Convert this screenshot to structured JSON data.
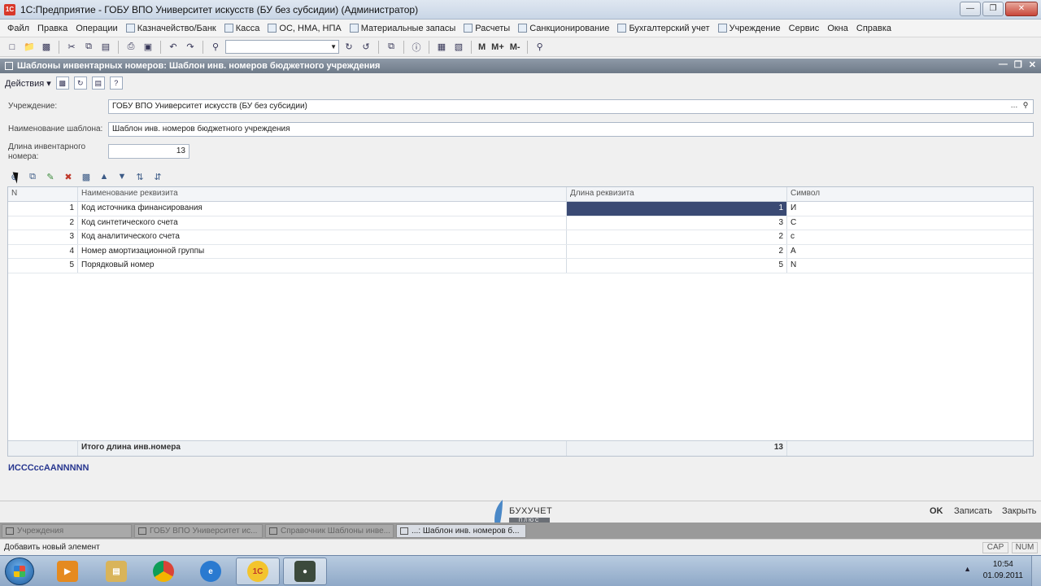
{
  "window": {
    "title": "1С:Предприятие - ГОБУ ВПО Университет искусств (БУ без субсидии) (Администратор)"
  },
  "menu": [
    {
      "label": "Файл",
      "icon": ""
    },
    {
      "label": "Правка",
      "icon": ""
    },
    {
      "label": "Операции",
      "icon": ""
    },
    {
      "label": "Казначейство/Банк",
      "icon": "bank-icon"
    },
    {
      "label": "Касса",
      "icon": "cash-icon"
    },
    {
      "label": "ОС, НМА, НПА",
      "icon": "assets-icon"
    },
    {
      "label": "Материальные запасы",
      "icon": "materials-icon"
    },
    {
      "label": "Расчеты",
      "icon": "settlements-icon"
    },
    {
      "label": "Санкционирование",
      "icon": "sanction-icon"
    },
    {
      "label": "Бухгалтерский учет",
      "icon": "accounting-icon"
    },
    {
      "label": "Учреждение",
      "icon": "institution-icon"
    },
    {
      "label": "Сервис",
      "icon": ""
    },
    {
      "label": "Окна",
      "icon": ""
    },
    {
      "label": "Справка",
      "icon": ""
    }
  ],
  "toolbar": {
    "m_label": "M",
    "m_plus_label": "M+",
    "m_minus_label": "M-"
  },
  "document": {
    "header_title": "Шаблоны инвентарных номеров: Шаблон инв. номеров бюджетного учреждения",
    "actions_label": "Действия"
  },
  "form": {
    "institution_label": "Учреждение:",
    "institution_value": "ГОБУ ВПО Университет искусств (БУ без субсидии)",
    "template_name_label": "Наименование шаблона:",
    "template_name_value": "Шаблон инв. номеров бюджетного учреждения",
    "inv_length_label_1": "Длина инвентарного",
    "inv_length_label_2": "номера:",
    "inv_length_value": "13"
  },
  "grid": {
    "columns": [
      "N",
      "Наименование реквизита",
      "Длина реквизита",
      "Символ"
    ],
    "rows": [
      {
        "n": "1",
        "name": "Код источника финансирования",
        "length": "1",
        "symbol": "И"
      },
      {
        "n": "2",
        "name": "Код синтетического счета",
        "length": "3",
        "symbol": "С"
      },
      {
        "n": "3",
        "name": "Код аналитического счета",
        "length": "2",
        "symbol": "с"
      },
      {
        "n": "4",
        "name": "Номер амортизационной группы",
        "length": "2",
        "symbol": "А"
      },
      {
        "n": "5",
        "name": "Порядковый номер",
        "length": "5",
        "symbol": "N"
      }
    ],
    "footer_label": "Итого длина инв.номера",
    "footer_total": "13"
  },
  "inv_mask": "ИСССссААNNNNN",
  "buttons": {
    "ok": "OK",
    "save": "Записать",
    "close": "Закрыть"
  },
  "logo": {
    "brand": "БУХУЧЕТ",
    "sub": "ПЛЮС"
  },
  "window_tabs": [
    {
      "label": "Учреждения",
      "active": false
    },
    {
      "label": "ГОБУ ВПО Университет ис...",
      "active": false
    },
    {
      "label": "Справочник Шаблоны инве...",
      "active": false
    },
    {
      "label": "...: Шаблон инв. номеров б...",
      "active": true
    }
  ],
  "status": {
    "message": "Добавить новый элемент",
    "cap": "CAP",
    "num": "NUM"
  },
  "taskbar": {
    "time": "10:54",
    "date": "01.09.2011"
  },
  "colors": {
    "selection": "#3a4a74",
    "mask_text": "#27368f",
    "doc_header": "#6e7a88"
  }
}
